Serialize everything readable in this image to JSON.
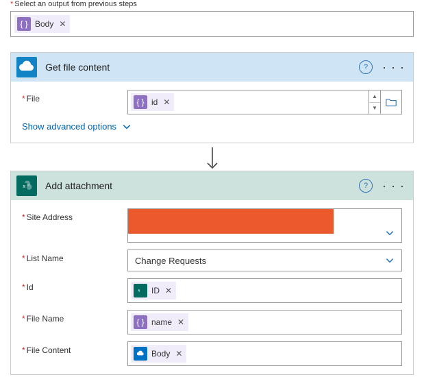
{
  "topLabel": "Select an output from previous steps",
  "topPill": {
    "label": "Body",
    "iconGlyph": "{ }"
  },
  "action1": {
    "title": "Get file content",
    "fileLabel": "File",
    "filePill": {
      "label": "id",
      "iconGlyph": "{ }"
    },
    "showAdvanced": "Show advanced options"
  },
  "action2": {
    "title": "Add attachment",
    "rows": {
      "siteAddress": {
        "label": "Site Address"
      },
      "listName": {
        "label": "List Name",
        "value": "Change Requests"
      },
      "id": {
        "label": "Id",
        "pill": {
          "label": "ID",
          "iconGlyph": "s",
          "cls": "icon-darkcyan"
        }
      },
      "fileName": {
        "label": "File Name",
        "pill": {
          "label": "name",
          "iconGlyph": "{ }",
          "cls": "icon-purple"
        }
      },
      "fileContent": {
        "label": "File Content",
        "pill": {
          "label": "Body",
          "iconGlyph": "☁",
          "cls": "icon-blue"
        }
      }
    }
  }
}
